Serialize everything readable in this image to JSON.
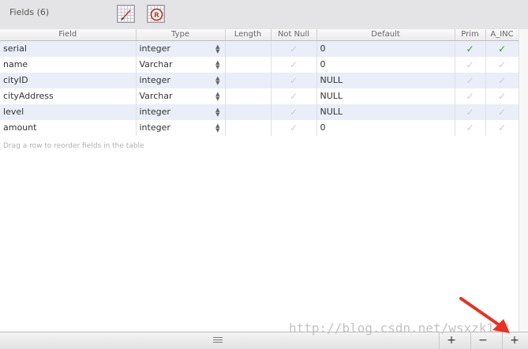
{
  "header": {
    "title": "Fields (6)",
    "icons": [
      "edit-field-icon",
      "remove-field-icon"
    ]
  },
  "table": {
    "columns": [
      "Field",
      "Type",
      "Length",
      "Not Null",
      "Default",
      "Prim",
      "A_INC"
    ],
    "rows": [
      {
        "field": "serial",
        "type": "integer",
        "length": "",
        "not_null": false,
        "default": "0",
        "prim": true,
        "ainc": true
      },
      {
        "field": "name",
        "type": "Varchar",
        "length": "",
        "not_null": false,
        "default": "0",
        "prim": false,
        "ainc": false
      },
      {
        "field": "cityID",
        "type": "integer",
        "length": "",
        "not_null": false,
        "default": "NULL",
        "prim": false,
        "ainc": false
      },
      {
        "field": "cityAddress",
        "type": "Varchar",
        "length": "",
        "not_null": false,
        "default": "NULL",
        "prim": false,
        "ainc": false
      },
      {
        "field": "level",
        "type": "integer",
        "length": "",
        "not_null": false,
        "default": "NULL",
        "prim": false,
        "ainc": false
      },
      {
        "field": "amount",
        "type": "integer",
        "length": "",
        "not_null": false,
        "default": "0",
        "prim": false,
        "ainc": false
      }
    ],
    "hint": "Drag a row to reorder fields in the table"
  },
  "footer": {
    "add_label": "+",
    "remove_label": "−",
    "add2_label": "+"
  },
  "watermark": "http://blog.csdn.net/wsxzk123",
  "colors": {
    "check_on": "#1fa51f",
    "check_off": "#cfcfcf",
    "row_alt": "#e9eef8",
    "annotation_arrow": "#e8321f"
  }
}
